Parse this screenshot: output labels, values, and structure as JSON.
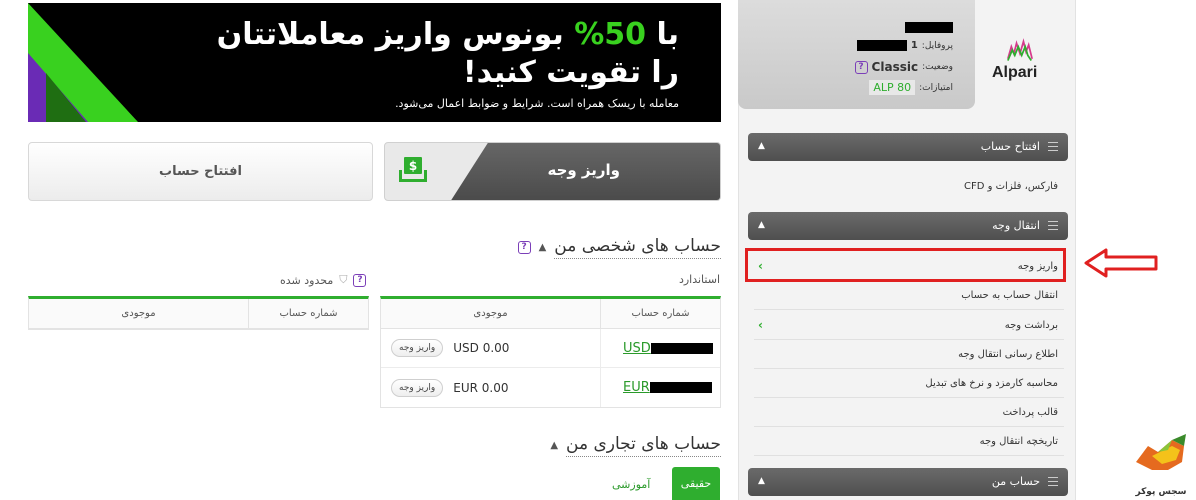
{
  "banner": {
    "line1_prefix": "با",
    "line1_highlight": "50%",
    "line1_suffix": "بونوس واریز معاملاتتان",
    "line2": "را تقویت کنید!",
    "disclaimer": "معامله با ریسک همراه است. شرایط و ضوابط اعمال می‌شود."
  },
  "actions": {
    "open_account": "افتتاح حساب",
    "deposit": "واریز وجه"
  },
  "personal_accounts": {
    "title": "حساب های شخصی من",
    "standard_label": "استاندارد",
    "restricted_label": "محدود شده",
    "standard_table": {
      "headers": [
        "شماره حساب",
        "موجودی"
      ],
      "rows": [
        {
          "currency": "USD",
          "balance": "USD 0.00",
          "action": "واریز وجه"
        },
        {
          "currency": "EUR",
          "balance": "EUR 0.00",
          "action": "واریز وجه"
        }
      ]
    },
    "restricted_table": {
      "headers": [
        "شماره حساب",
        "موجودی"
      ]
    }
  },
  "business_accounts": {
    "title": "حساب های تجاری من",
    "tab_real": "حقیقی",
    "tab_demo": "آموزشی"
  },
  "profile": {
    "profile_label": "پروفایل:",
    "profile_value_prefix": "1",
    "status_label": "وضعیت:",
    "status_value": "Classic",
    "points_label": "امتیازات:",
    "points_value": "ALP 80"
  },
  "logo": {
    "text": "Alpari"
  },
  "sidebar": {
    "sections": [
      {
        "title": "افتتاح حساب"
      },
      {
        "title": "انتقال وجه"
      },
      {
        "title": "حساب من"
      }
    ],
    "open_account_items": [
      "فارکس، فلزات و CFD"
    ],
    "transfer_items": [
      {
        "label": "واریز وجه",
        "chevron": true
      },
      {
        "label": "انتقال حساب به حساب",
        "chevron": false
      },
      {
        "label": "برداشت وجه",
        "chevron": true
      },
      {
        "label": "اطلاع رسانی انتقال وجه",
        "chevron": false
      },
      {
        "label": "محاسبه کارمزد و نرخ های تبدیل",
        "chevron": false
      },
      {
        "label": "قالب پرداخت",
        "chevron": false
      },
      {
        "label": "تاریخچه انتقال وجه",
        "chevron": false
      }
    ]
  },
  "watermark": {
    "text": "سجس پوکر"
  },
  "colors": {
    "accent_green": "#2fae2f",
    "banner_green": "#39d11f",
    "highlight_red": "#e02020",
    "menu_dark": "#555555"
  }
}
